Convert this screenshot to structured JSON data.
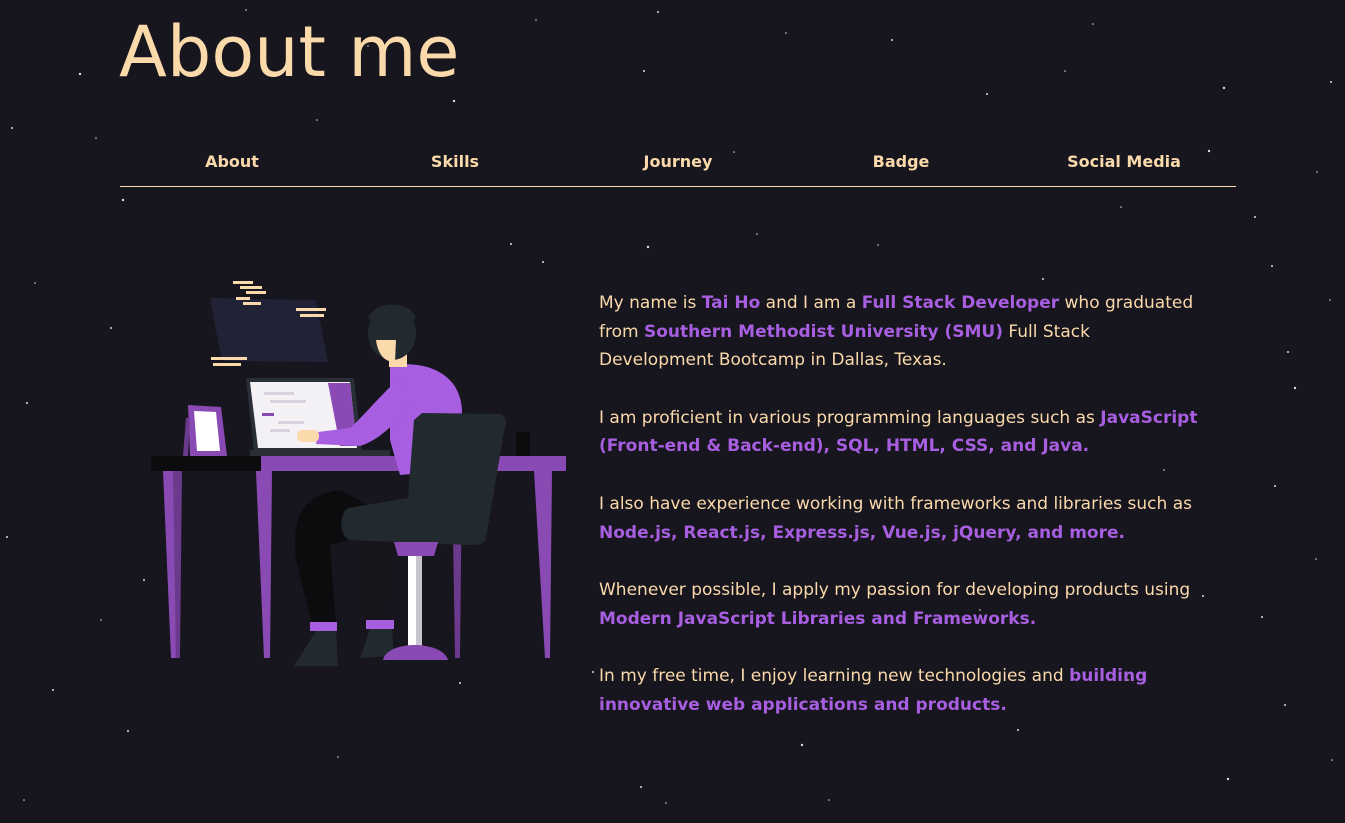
{
  "page": {
    "title": "About me"
  },
  "nav": {
    "items": [
      {
        "label": "About"
      },
      {
        "label": "Skills"
      },
      {
        "label": "Journey"
      },
      {
        "label": "Badge"
      },
      {
        "label": "Social Media"
      }
    ]
  },
  "colors": {
    "background": "#17151d",
    "accent_text": "#fad9aa",
    "highlight": "#a75ee0",
    "purple": "#8a4ab4",
    "dark": "#222a30"
  },
  "bio": {
    "p1": {
      "a": "My name is ",
      "b": "Tai Ho",
      "c": " and I am a ",
      "d": "Full Stack Developer",
      "e": " who graduated from ",
      "f": "Southern Methodist University (SMU)",
      "g": " Full Stack Development Bootcamp in Dallas, Texas."
    },
    "p2": {
      "a": "I am proficient in various programming languages such as ",
      "b": "JavaScript (Front-end & Back-end), SQL, HTML, CSS, and Java."
    },
    "p3": {
      "a": "I also have experience working with frameworks and libraries such as ",
      "b": "Node.js, React.js, Express.js, Vue.js, jQuery, and more."
    },
    "p4": {
      "a": "Whenever possible, I apply my passion for developing products using ",
      "b": "Modern JavaScript Libraries and Frameworks."
    },
    "p5": {
      "a": "In my free time, I enjoy learning new technologies and ",
      "b": "building innovative web applications and products."
    }
  }
}
